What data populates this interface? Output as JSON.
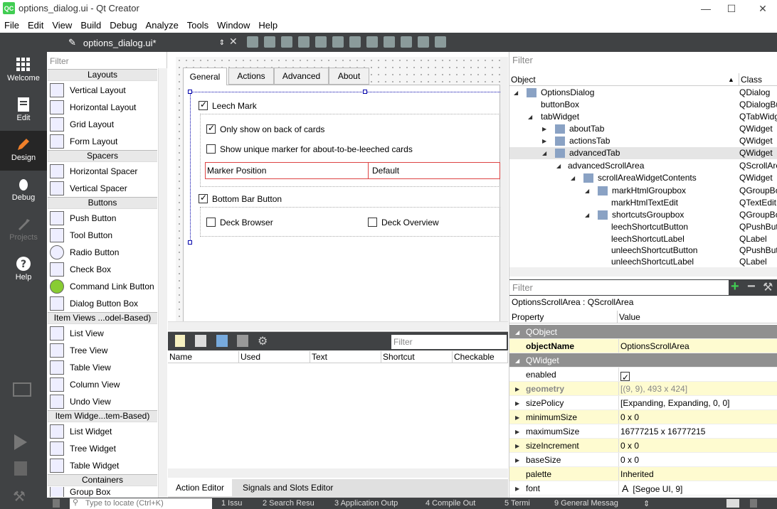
{
  "window": {
    "title": "options_dialog.ui - Qt Creator",
    "logo": "QC"
  },
  "menu": [
    "File",
    "Edit",
    "View",
    "Build",
    "Debug",
    "Analyze",
    "Tools",
    "Window",
    "Help"
  ],
  "modes": [
    {
      "label": "Welcome",
      "icon": "grid-icon"
    },
    {
      "label": "Edit",
      "icon": "document-icon"
    },
    {
      "label": "Design",
      "icon": "pen-icon"
    },
    {
      "label": "Debug",
      "icon": "bug-icon"
    },
    {
      "label": "Projects",
      "icon": "wrench-icon"
    },
    {
      "label": "Help",
      "icon": "help-icon"
    }
  ],
  "editor": {
    "file": "options_dialog.ui*"
  },
  "widgetbox": {
    "filter_placeholder": "Filter",
    "categories": [
      "Layouts",
      "Spacers",
      "Buttons",
      "Item Views ...odel-Based)",
      "Item Widge...tem-Based)",
      "Containers"
    ],
    "items": [
      "Vertical Layout",
      "Horizontal Layout",
      "Grid Layout",
      "Form Layout",
      "Horizontal Spacer",
      "Vertical Spacer",
      "Push Button",
      "Tool Button",
      "Radio Button",
      "Check Box",
      "Command Link Button",
      "Dialog Button Box",
      "List View",
      "Tree View",
      "Table View",
      "Column View",
      "Undo View",
      "List Widget",
      "Tree Widget",
      "Table Widget",
      "Group Box"
    ]
  },
  "form": {
    "tabs": [
      "General",
      "Actions",
      "Advanced",
      "About"
    ],
    "leech_mark": "Leech Mark",
    "only_back": "Only show on back of cards",
    "unique_marker": "Show unique marker for about-to-be-leeched cards",
    "marker_position_label": "Marker Position",
    "marker_position_value": "Default",
    "bottom_bar": "Bottom Bar Button",
    "deck_browser": "Deck Browser",
    "deck_overview": "Deck Overview"
  },
  "action_editor": {
    "filter_placeholder": "Filter",
    "columns": [
      "Name",
      "Used",
      "Text",
      "Shortcut",
      "Checkable"
    ]
  },
  "bottom_tabs": [
    "Action Editor",
    "Signals and Slots Editor"
  ],
  "object_inspector": {
    "filter_placeholder": "Filter",
    "col_object": "Object",
    "col_class": "Class",
    "rows": [
      {
        "name": "OptionsDialog",
        "class": "QDialog"
      },
      {
        "name": "buttonBox",
        "class": "QDialogButtonBox"
      },
      {
        "name": "tabWidget",
        "class": "QTabWidget"
      },
      {
        "name": "aboutTab",
        "class": "QWidget"
      },
      {
        "name": "actionsTab",
        "class": "QWidget"
      },
      {
        "name": "advancedTab",
        "class": "QWidget"
      },
      {
        "name": "advancedScrollArea",
        "class": "QScrollArea"
      },
      {
        "name": "scrollAreaWidgetContents",
        "class": "QWidget"
      },
      {
        "name": "markHtmlGroupbox",
        "class": "QGroupBox"
      },
      {
        "name": "markHtmlTextEdit",
        "class": "QTextEdit"
      },
      {
        "name": "shortcutsGroupbox",
        "class": "QGroupBox"
      },
      {
        "name": "leechShortcutButton",
        "class": "QPushButton"
      },
      {
        "name": "leechShortcutLabel",
        "class": "QLabel"
      },
      {
        "name": "unleechShortcutButton",
        "class": "QPushButton"
      },
      {
        "name": "unleechShortcutLabel",
        "class": "QLabel"
      }
    ]
  },
  "property_editor": {
    "filter_placeholder": "Filter",
    "title": "OptionsScrollArea : QScrollArea",
    "col_property": "Property",
    "col_value": "Value",
    "rows": [
      {
        "section": "QObject"
      },
      {
        "name": "objectName",
        "value": "OptionsScrollArea"
      },
      {
        "section": "QWidget"
      },
      {
        "name": "enabled",
        "value": "✓"
      },
      {
        "name": "geometry",
        "value": "[(9, 9), 493 x 424]"
      },
      {
        "name": "sizePolicy",
        "value": "[Expanding, Expanding, 0, 0]"
      },
      {
        "name": "minimumSize",
        "value": "0 x 0"
      },
      {
        "name": "maximumSize",
        "value": "16777215 x 16777215"
      },
      {
        "name": "sizeIncrement",
        "value": "0 x 0"
      },
      {
        "name": "baseSize",
        "value": "0 x 0"
      },
      {
        "name": "palette",
        "value": "Inherited"
      },
      {
        "name": "font",
        "value": "[Segoe UI, 9]"
      }
    ]
  },
  "statusbar": {
    "locate_placeholder": "Type to locate (Ctrl+K)",
    "panes": [
      "1 Issu",
      "2 Search Resu",
      "3 Application Outp",
      "4 Compile Out",
      "5 Termi",
      "9 General Messag"
    ]
  },
  "colors": {
    "modebar": "#404244",
    "accent": "#41cd52",
    "section": "#909090",
    "yellow": "#fefbd0"
  }
}
